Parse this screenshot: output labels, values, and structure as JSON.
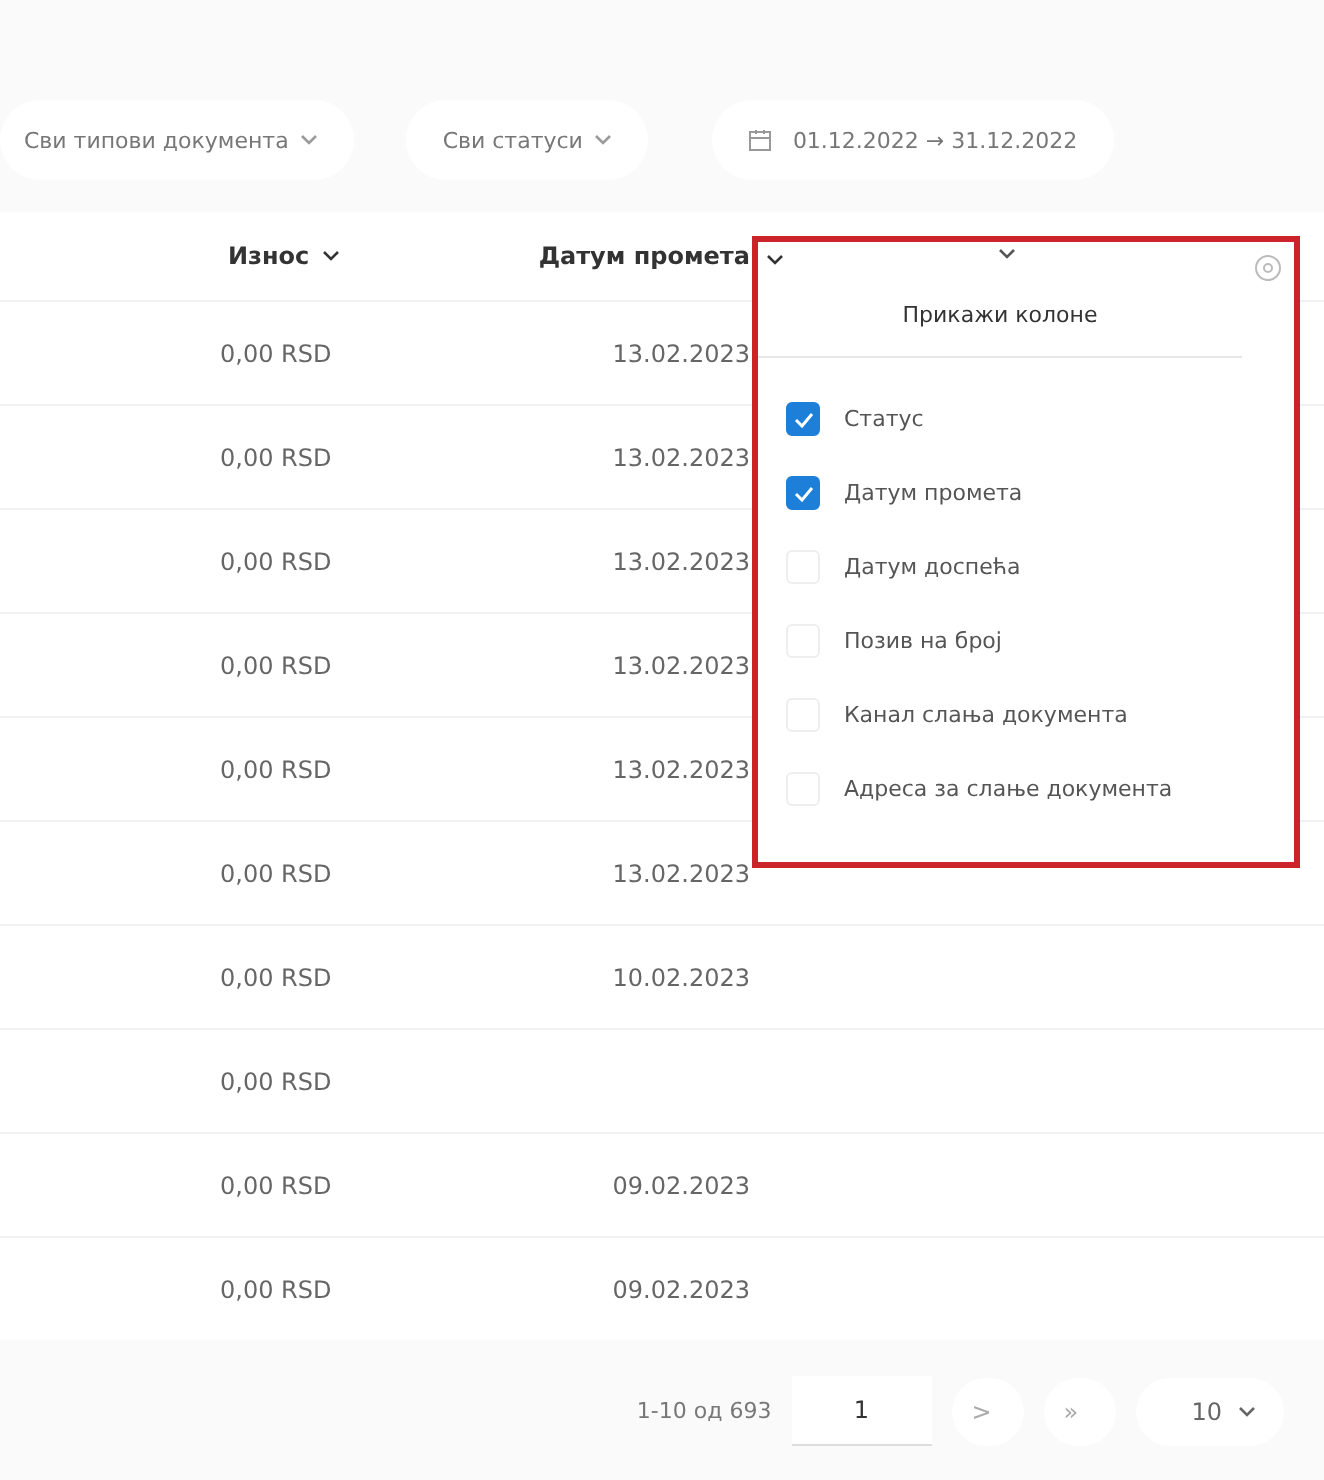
{
  "filters": [
    {
      "label": "Сви типови документа"
    },
    {
      "label": "Сви статуси"
    }
  ],
  "date_range": {
    "from": "01.12.2022",
    "arrow": "→",
    "to": "31.12.2022"
  },
  "table": {
    "columns": [
      {
        "label": "Износ"
      },
      {
        "label": "Датум промета"
      }
    ],
    "rows": [
      [
        "0,00 RSD",
        "13.02.2023"
      ],
      [
        "0,00 RSD",
        "13.02.2023"
      ],
      [
        "0,00 RSD",
        "13.02.2023"
      ],
      [
        "0,00 RSD",
        "13.02.2023"
      ],
      [
        "0,00 RSD",
        "13.02.2023"
      ],
      [
        "0,00 RSD",
        "13.02.2023"
      ],
      [
        "0,00 RSD",
        "10.02.2023"
      ],
      [
        "0,00 RSD",
        ""
      ],
      [
        "0,00 RSD",
        "09.02.2023"
      ],
      [
        "0,00 RSD",
        "09.02.2023"
      ]
    ]
  },
  "column_menu": {
    "title": "Прикажи колоне",
    "options": [
      {
        "label": "Статус",
        "checked": true
      },
      {
        "label": "Датум промета",
        "checked": true
      },
      {
        "label": "Датум доспећа",
        "checked": false
      },
      {
        "label": "Позив на број",
        "checked": false
      },
      {
        "label": "Канал слања документа",
        "checked": false
      },
      {
        "label": "Адреса за слање документа",
        "checked": false
      }
    ]
  },
  "pagination": {
    "range": "1-10 од 693",
    "page": "1",
    "next": ">",
    "last": "»",
    "page_size": "10"
  }
}
